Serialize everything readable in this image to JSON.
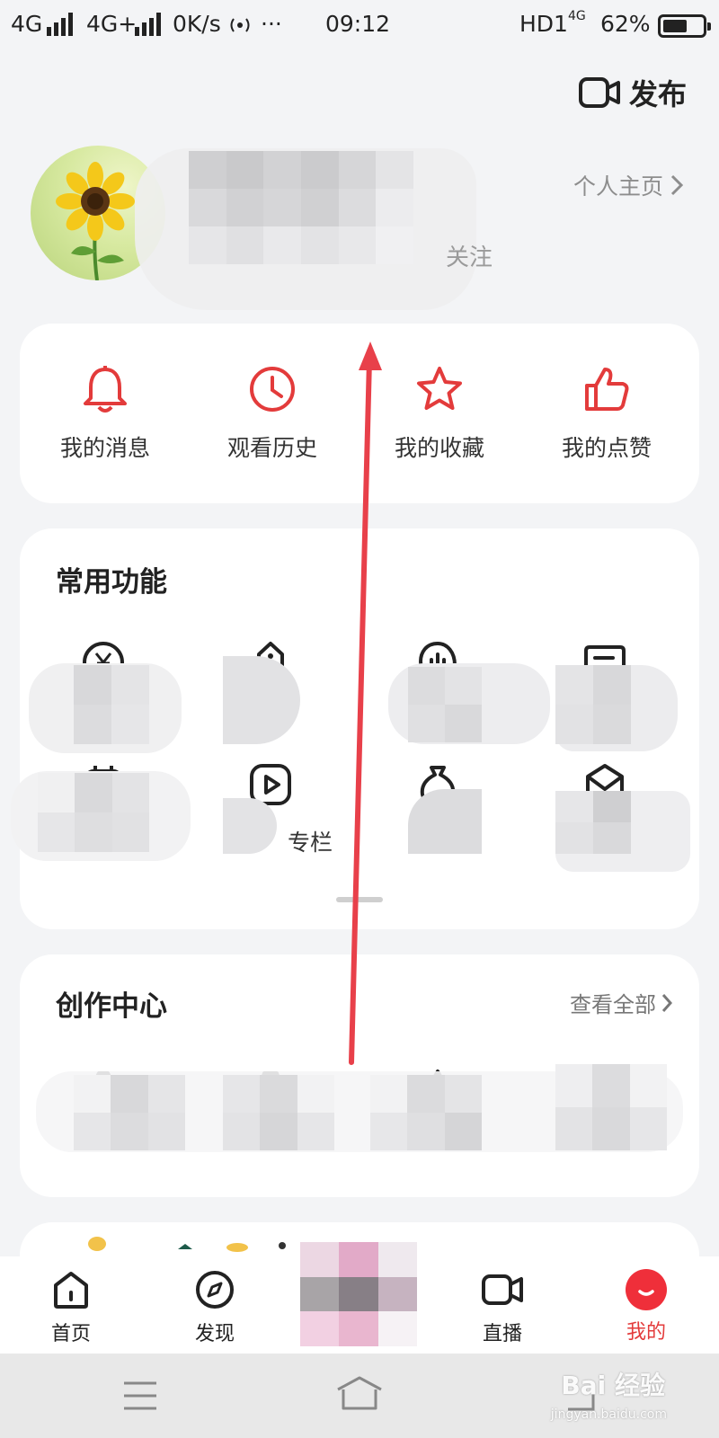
{
  "status_bar": {
    "network1": "4G",
    "network2": "4G+",
    "speed": "0K/s",
    "dots": "···",
    "time": "09:12",
    "hd": "HD1",
    "net_small": "4G",
    "battery": "62%",
    "battery_level": 0.62
  },
  "header": {
    "publish_label": "发布"
  },
  "profile": {
    "homepage_label": "个人主页",
    "follow_fragment": "关注"
  },
  "quick_actions": [
    {
      "label": "我的消息",
      "icon": "bell-icon"
    },
    {
      "label": "观看历史",
      "icon": "clock-icon"
    },
    {
      "label": "我的收藏",
      "icon": "star-icon"
    },
    {
      "label": "我的点赞",
      "icon": "thumbs-up-icon"
    }
  ],
  "common_functions": {
    "title": "常用功能",
    "visible_fragments": {
      "item6_partial": "专栏"
    },
    "icons": [
      "yen-icon",
      "tag-icon",
      "audio-icon",
      "message-icon",
      "calendar-icon",
      "play-icon",
      "money-bag-icon",
      "envelope-icon"
    ]
  },
  "creator_center": {
    "title": "创作中心",
    "view_all_label": "查看全部",
    "icons": [
      "camera-icon",
      "video-icon",
      "crown-icon",
      "gift-icon"
    ]
  },
  "bottom_nav": [
    {
      "label": "首页",
      "icon": "home-icon"
    },
    {
      "label": "发现",
      "icon": "compass-icon"
    },
    {
      "label": "",
      "icon": "center-avatar"
    },
    {
      "label": "直播",
      "icon": "live-camera-icon"
    },
    {
      "label": "我的",
      "icon": "me-icon",
      "active": true
    }
  ],
  "watermark": {
    "text": "Bai 经验",
    "sub": "jingyan.baidu.com"
  },
  "colors": {
    "accent": "#e33b3b",
    "background": "#f3f4f6",
    "card": "#ffffff",
    "arrow": "#e8404a"
  }
}
